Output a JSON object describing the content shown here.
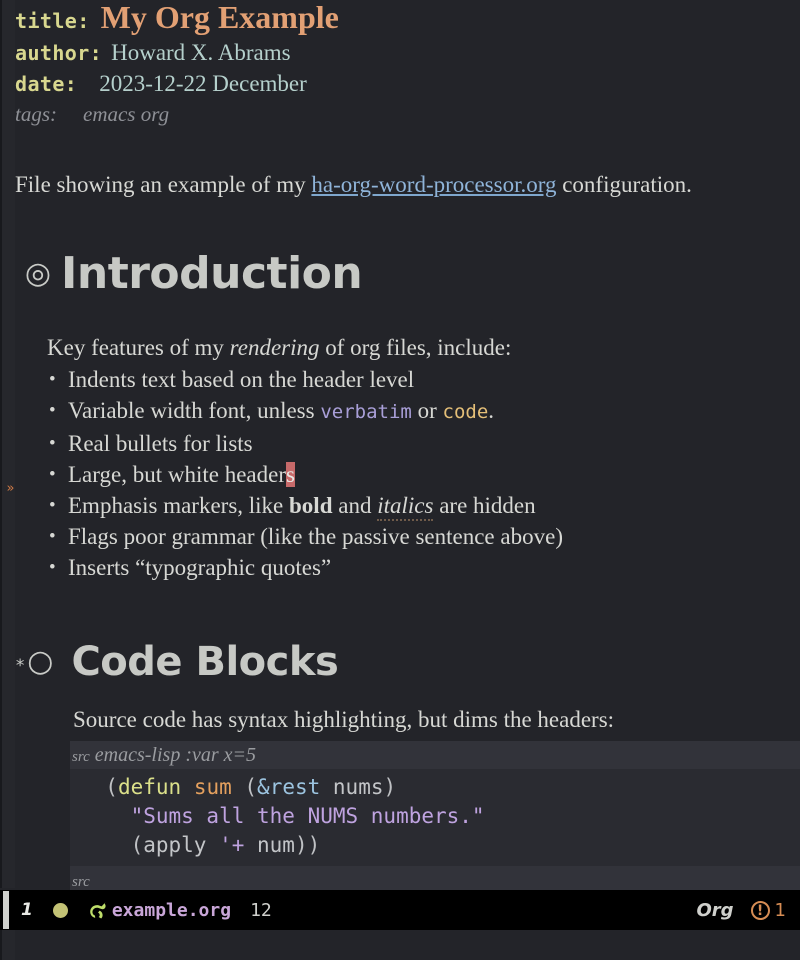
{
  "document": {
    "keywords": [
      {
        "name": "title",
        "label": "title:",
        "value": "My Org Example"
      },
      {
        "name": "author",
        "label": "author:",
        "value": "Howard X. Abrams"
      },
      {
        "name": "date",
        "label": "date:",
        "value": "2023-12-22 December"
      }
    ],
    "tags": {
      "label": "tags:",
      "value": "emacs org"
    },
    "intro": {
      "before_link": "File showing an example of my ",
      "link_text": "ha-org-word-processor.org",
      "after_link": " configuration."
    },
    "sections": [
      {
        "id": "introduction",
        "bullet": "◎",
        "stars": "",
        "title": "Introduction",
        "lead": {
          "before_italic": "Key features of my ",
          "italic": "rendering",
          "after_italic": " of org files, include:"
        },
        "items": [
          {
            "id": "indents",
            "text": "Indents text based on the header level"
          },
          {
            "id": "varwidth",
            "prefix": "Variable width font, unless ",
            "verbatim": "verbatim",
            "middle": " or ",
            "code": "code",
            "suffix": "."
          },
          {
            "id": "bullets",
            "text": "Real bullets for lists"
          },
          {
            "id": "headers",
            "prefix": "Large, but white header",
            "cursor_char": "s",
            "suffix": ""
          },
          {
            "id": "emphasis",
            "prefix": "Emphasis markers, like ",
            "bold": "bold",
            "middle": " and ",
            "italic": "italics",
            "suffix": " are hidden"
          },
          {
            "id": "grammar",
            "text": "Flags poor grammar (like the passive sentence above)"
          },
          {
            "id": "quotes",
            "text": "Inserts “typographic quotes”"
          }
        ]
      },
      {
        "id": "code-blocks",
        "bullet": "○",
        "stars": "*",
        "title": "Code Blocks",
        "lead_text": "Source code has syntax highlighting, but dims the headers:",
        "src_block": {
          "begin_keyword": "src",
          "begin_args": "emacs-lisp :var x=5",
          "end_keyword": "src",
          "lines": [
            {
              "id": "defun-line",
              "tokens": [
                {
                  "cls": "tok-paren",
                  "t": "  ("
                },
                {
                  "cls": "tok-defun",
                  "t": "defun"
                },
                {
                  "cls": "tok-paren",
                  "t": " "
                },
                {
                  "cls": "tok-fname",
                  "t": "sum"
                },
                {
                  "cls": "tok-paren",
                  "t": " ("
                },
                {
                  "cls": "tok-amp",
                  "t": "&rest"
                },
                {
                  "cls": "tok-var",
                  "t": " nums"
                },
                {
                  "cls": "tok-paren",
                  "t": ")"
                }
              ]
            },
            {
              "id": "docstring-line",
              "tokens": [
                {
                  "cls": "tok-str",
                  "t": "    \"Sums all the NUMS numbers.\""
                }
              ]
            },
            {
              "id": "apply-line",
              "tokens": [
                {
                  "cls": "tok-paren",
                  "t": "    ("
                },
                {
                  "cls": "tok-var",
                  "t": "apply "
                },
                {
                  "cls": "tok-str",
                  "t": "'+"
                },
                {
                  "cls": "tok-var",
                  "t": " num"
                },
                {
                  "cls": "tok-paren",
                  "t": "))"
                }
              ]
            }
          ]
        }
      }
    ],
    "fringe_marker": "»"
  },
  "modeline": {
    "window_number": "1",
    "state_dot_color": "#c3c275",
    "buffer_icon": "unicorn-icon",
    "buffer_name": "example.org",
    "position": "12",
    "major_mode": "Org",
    "warning_icon": "!",
    "warning_count": "1",
    "warning_color": "#d78d54"
  }
}
